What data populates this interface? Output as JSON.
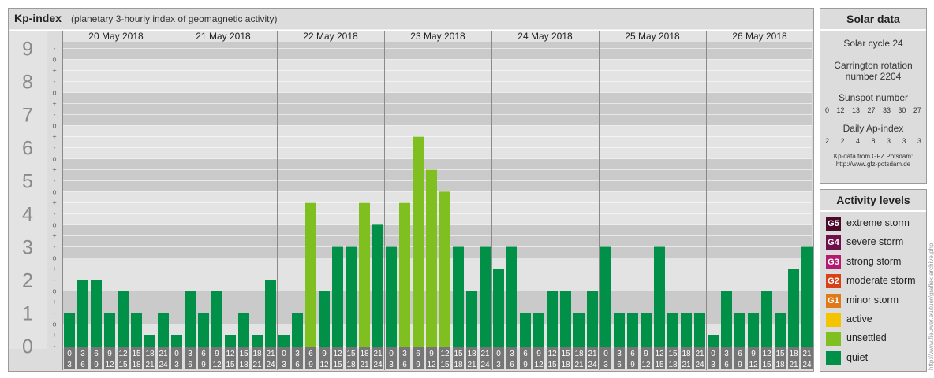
{
  "header": {
    "title": "Kp-index",
    "subtitle": "(planetary 3-hourly index of geomagnetic activity)"
  },
  "chart_data": {
    "type": "bar",
    "title": "Kp-index",
    "subtitle": "(planetary 3-hourly index of geomagnetic activity)",
    "y_ticks": [
      "0",
      "1",
      "2",
      "3",
      "4",
      "5",
      "6",
      "7",
      "8",
      "9"
    ],
    "y_minor_ticks": [
      "-",
      "o",
      "+"
    ],
    "ylim": [
      0,
      9.33
    ],
    "days": [
      "20 May 2018",
      "21 May 2018",
      "22 May 2018",
      "23 May 2018",
      "24 May 2018",
      "25 May 2018",
      "26 May 2018"
    ],
    "interval_labels": [
      [
        "0",
        "3"
      ],
      [
        "3",
        "6"
      ],
      [
        "6",
        "9"
      ],
      [
        "9",
        "12"
      ],
      [
        "12",
        "15"
      ],
      [
        "15",
        "18"
      ],
      [
        "18",
        "21"
      ],
      [
        "21",
        "24"
      ]
    ],
    "values": [
      [
        1.0,
        2.0,
        2.0,
        1.0,
        1.67,
        1.0,
        0.33,
        1.0
      ],
      [
        0.33,
        1.67,
        1.0,
        1.67,
        0.33,
        1.0,
        0.33,
        2.0
      ],
      [
        0.33,
        1.0,
        4.33,
        1.67,
        3.0,
        3.0,
        4.33,
        3.67
      ],
      [
        3.0,
        4.33,
        6.33,
        5.33,
        4.67,
        3.0,
        1.67,
        3.0
      ],
      [
        2.33,
        3.0,
        1.0,
        1.0,
        1.67,
        1.67,
        1.0,
        1.67
      ],
      [
        3.0,
        1.0,
        1.0,
        1.0,
        3.0,
        1.0,
        1.0,
        1.0
      ],
      [
        0.33,
        1.67,
        1.0,
        1.0,
        1.67,
        1.0,
        2.33,
        3.0
      ]
    ],
    "band_colors": [
      "#ffffff",
      "#cacaca",
      "#e3e3e3"
    ],
    "grid": true
  },
  "solar": {
    "title": "Solar data",
    "cycle": "Solar cycle 24",
    "carrington_line1": "Carrington rotation",
    "carrington_line2": "number 2204",
    "sunspot_title": "Sunspot number",
    "sunspot_values": [
      "0",
      "12",
      "13",
      "27",
      "33",
      "30",
      "27"
    ],
    "ap_title": "Daily Ap-index",
    "ap_values": [
      "2",
      "2",
      "4",
      "8",
      "3",
      "3",
      "3"
    ],
    "credit_line1": "Kp-data from GFZ Potsdam:",
    "credit_line2": "http://www.gfz-potsdam.de"
  },
  "levels": {
    "title": "Activity levels",
    "items": [
      {
        "badge": "G5",
        "label": "extreme storm",
        "color": "#4b0a28"
      },
      {
        "badge": "G4",
        "label": "severe storm",
        "color": "#70104a"
      },
      {
        "badge": "G3",
        "label": "strong storm",
        "color": "#b51a70"
      },
      {
        "badge": "G2",
        "label": "moderate storm",
        "color": "#d9401a"
      },
      {
        "badge": "G1",
        "label": "minor storm",
        "color": "#e07a18"
      },
      {
        "badge": "",
        "label": "active",
        "color": "#f5c400"
      },
      {
        "badge": "",
        "label": "unsettled",
        "color": "#7fbf20"
      },
      {
        "badge": "",
        "label": "quiet",
        "color": "#009047"
      }
    ]
  },
  "colors": {
    "quiet": "#009047",
    "unsettled": "#7fbf20",
    "label_bg": "#767676"
  },
  "vertical_credit": "http://www.fieuwer.eu/tuer/grafiek archive.php"
}
